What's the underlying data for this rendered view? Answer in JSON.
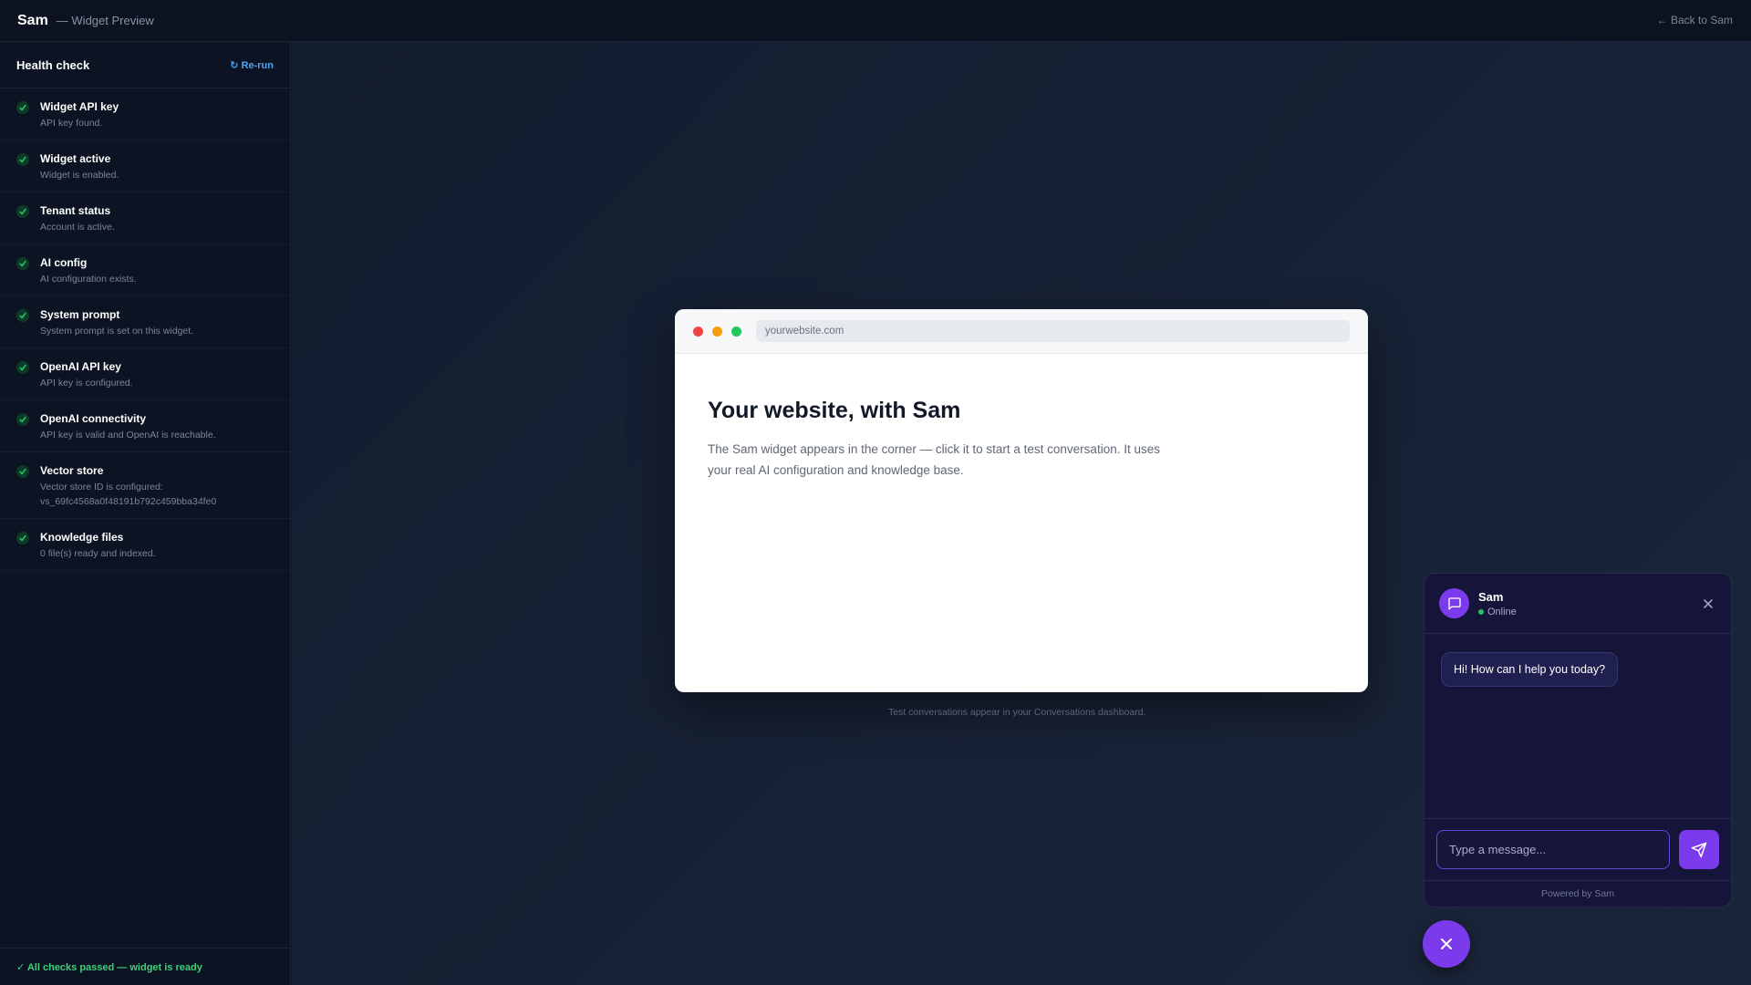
{
  "topbar": {
    "brand": "Sam",
    "subtitle": "— Widget Preview",
    "back_label": "← Back to Sam"
  },
  "sidebar": {
    "title": "Health check",
    "rerun_label": "↻ Re-run",
    "checks": [
      {
        "name": "Widget API key",
        "desc": "API key found.",
        "status": "pass"
      },
      {
        "name": "Widget active",
        "desc": "Widget is enabled.",
        "status": "pass"
      },
      {
        "name": "Tenant status",
        "desc": "Account is active.",
        "status": "pass"
      },
      {
        "name": "AI config",
        "desc": "AI configuration exists.",
        "status": "pass"
      },
      {
        "name": "System prompt",
        "desc": "System prompt is set on this widget.",
        "status": "pass"
      },
      {
        "name": "OpenAI API key",
        "desc": "API key is configured.",
        "status": "pass"
      },
      {
        "name": "OpenAI connectivity",
        "desc": "API key is valid and OpenAI is reachable.",
        "status": "pass"
      },
      {
        "name": "Vector store",
        "desc": "Vector store ID is configured:",
        "desc2": "vs_69fc4568a0f48191b792c459bba34fe0",
        "status": "pass"
      },
      {
        "name": "Knowledge files",
        "desc": "0 file(s) ready and indexed.",
        "status": "pass"
      }
    ],
    "footer": "✓ All checks passed — widget is ready"
  },
  "preview": {
    "url": "yourwebsite.com",
    "heading": "Your website, with Sam",
    "body": "The Sam widget appears in the corner — click it to start a test conversation. It uses your real AI configuration and knowledge base.",
    "caption": "Test conversations appear in your Conversations dashboard."
  },
  "widget": {
    "name": "Sam",
    "status": "Online",
    "greeting": "Hi! How can I help you today?",
    "input_placeholder": "Type a message...",
    "powered_by": "Powered by Sam"
  },
  "colors": {
    "accent": "#7c3aed",
    "success": "#22c55e",
    "link": "#4aa3f0",
    "traffic_red": "#ef4444",
    "traffic_yellow": "#f59e0b",
    "traffic_green": "#22c55e"
  }
}
